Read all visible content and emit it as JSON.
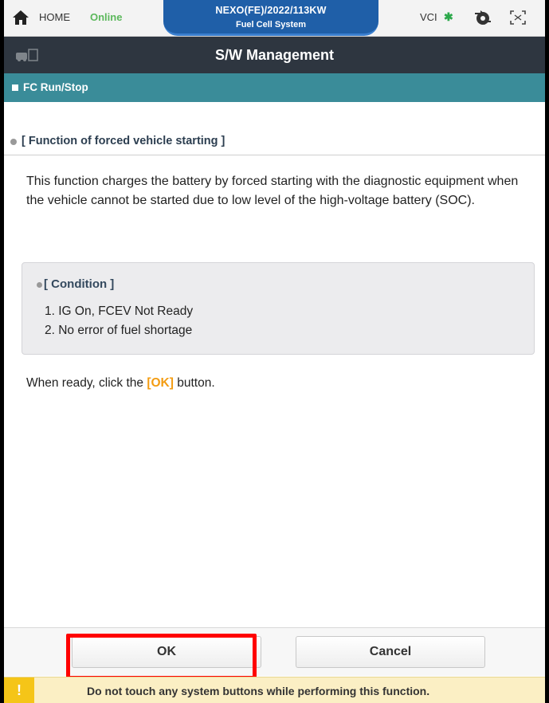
{
  "topbar": {
    "home_label": "HOME",
    "status": "Online",
    "vehicle_title": "NEXO(FE)/2022/113KW",
    "system_name": "Fuel Cell System",
    "vci_label": "VCI",
    "bluetooth_glyph": "✱",
    "icons": [
      "home-icon",
      "bluetooth-icon",
      "sync-icon",
      "fullscreen-icon"
    ]
  },
  "titlebar": {
    "title": "S/W Management",
    "icon": "vehicle-doc-icon"
  },
  "section": {
    "label": "FC Run/Stop"
  },
  "content": {
    "function_title": "[ Function of forced vehicle starting ]",
    "description": "This function charges the battery by forced starting with the diagnostic equipment when the vehicle cannot be started due to low level of the high-voltage battery (SOC).",
    "condition": {
      "title": "[ Condition ]",
      "items": [
        "1. IG On, FCEV Not Ready",
        "2. No error of fuel shortage"
      ]
    },
    "instruction": {
      "prefix": "When ready, click the ",
      "highlight": "[OK]",
      "suffix": " button."
    }
  },
  "buttons": {
    "ok_label": "OK",
    "cancel_label": "Cancel"
  },
  "warning": {
    "icon_glyph": "!",
    "text": "Do not touch any system buttons while performing this function."
  },
  "colors": {
    "vehicle_banner": "#1f5fa8",
    "titlebar": "#2e3640",
    "sectionbar": "#3a8c99",
    "online": "#5cb85c",
    "ok_highlight": "#f39c12",
    "annotation_outline": "#ff0000",
    "warning_bg": "#fbefc4",
    "warning_icon": "#f5c518"
  }
}
